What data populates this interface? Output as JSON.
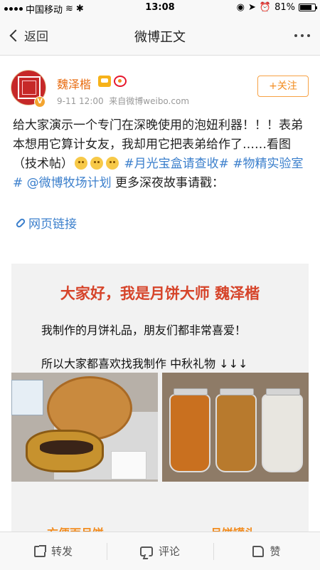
{
  "status_bar": {
    "carrier": "中国移动",
    "time": "13:08",
    "battery": "81%",
    "battery_level": 0.81
  },
  "nav": {
    "back_label": "返回",
    "title": "微博正文"
  },
  "post": {
    "user_name": "魏泽楷",
    "time": "9-11 12:00",
    "source": "来自微博weibo.com",
    "follow_label": "+关注",
    "text": {
      "part1": "给大家演示一个专门在深晚使用的泡妞利器！！！表弟本想用它算计女友，我却用它把表弟给作了……看图（技术帖）",
      "tag1": "#月光宝盒请查收#",
      "tag2": "#物精实验室#",
      "mention": "@微博牧场计划",
      "part2": " 更多深夜故事请戳："
    },
    "link_label": "网页链接"
  },
  "card": {
    "heading": "大家好，我是月饼大师 魏泽楷",
    "line1": "我制作的月饼礼品，朋友们都非常喜爱！",
    "line2": "所以大家都喜欢找我制作 中秋礼物 ↓↓↓",
    "caption_left": "方便面月饼",
    "caption_right": "月饼罐头"
  },
  "toolbar": {
    "repost_label": "转发",
    "comment_label": "评论",
    "like_label": "赞"
  }
}
